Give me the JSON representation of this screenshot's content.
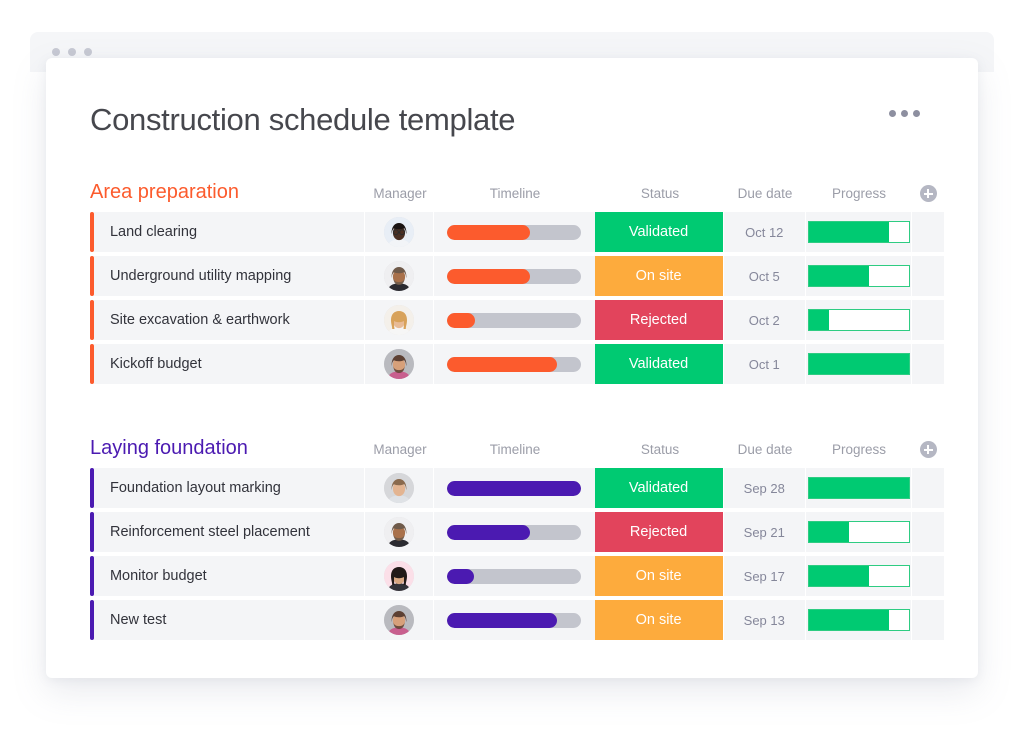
{
  "window": {
    "dots": [
      "close-dot",
      "minimize-dot",
      "maximize-dot"
    ]
  },
  "header": {
    "title": "Construction schedule template",
    "more_menu_label": "•••"
  },
  "columns": {
    "name": "",
    "manager": "Manager",
    "timeline": "Timeline",
    "status": "Status",
    "due_date": "Due date",
    "progress": "Progress",
    "add_column": "+"
  },
  "colors": {
    "group_1_accent": "#fc5b2d",
    "group_2_accent": "#4b1ab1",
    "status_validated": "#00ca72",
    "status_on_site": "#fdab3d",
    "status_rejected": "#e2445c",
    "progress_fill": "#00ca72",
    "timeline_track": "#c3c5cd",
    "row_background": "#f4f5f7",
    "title_text": "#46474d",
    "column_header_text": "#9b9da8"
  },
  "groups": [
    {
      "title": "Area preparation",
      "accent": "#fc5b2d",
      "rows": [
        {
          "name": "Land clearing",
          "manager": "avatar-woman-dark-glasses",
          "timeline_pct": 62,
          "status": "Validated",
          "status_color": "#00ca72",
          "due_date": "Oct 12",
          "progress_pct": 80
        },
        {
          "name": "Underground utility mapping",
          "manager": "avatar-man-beard-dark-shirt",
          "timeline_pct": 62,
          "status": "On site",
          "status_color": "#fdab3d",
          "due_date": "Oct 5",
          "progress_pct": 60
        },
        {
          "name": "Site excavation & earthwork",
          "manager": "avatar-woman-blonde",
          "timeline_pct": 21,
          "status": "Rejected",
          "status_color": "#e2445c",
          "due_date": "Oct 2",
          "progress_pct": 20
        },
        {
          "name": "Kickoff budget",
          "manager": "avatar-man-beard-floral",
          "timeline_pct": 82,
          "status": "Validated",
          "status_color": "#00ca72",
          "due_date": "Oct 1",
          "progress_pct": 100
        }
      ]
    },
    {
      "title": "Laying foundation",
      "accent": "#4b1ab1",
      "rows": [
        {
          "name": "Foundation layout marking",
          "manager": "avatar-man-short-hair",
          "timeline_pct": 100,
          "status": "Validated",
          "status_color": "#00ca72",
          "due_date": "Sep 28",
          "progress_pct": 100
        },
        {
          "name": "Reinforcement steel placement",
          "manager": "avatar-man-beard-dark-shirt",
          "timeline_pct": 62,
          "status": "Rejected",
          "status_color": "#e2445c",
          "due_date": "Sep 21",
          "progress_pct": 40
        },
        {
          "name": "Monitor budget",
          "manager": "avatar-woman-dark-hair-pink",
          "timeline_pct": 20,
          "status": "On site",
          "status_color": "#fdab3d",
          "due_date": "Sep 17",
          "progress_pct": 60
        },
        {
          "name": "New test",
          "manager": "avatar-man-beard-floral",
          "timeline_pct": 82,
          "status": "On site",
          "status_color": "#fdab3d",
          "due_date": "Sep 13",
          "progress_pct": 80
        }
      ]
    }
  ]
}
